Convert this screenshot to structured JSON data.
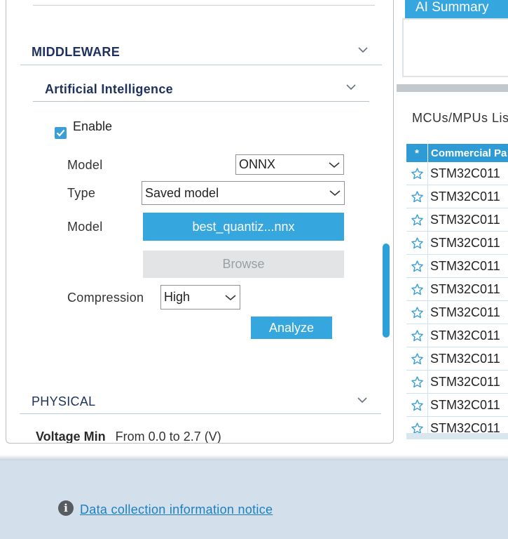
{
  "left_panel": {
    "middleware": {
      "title": "MIDDLEWARE"
    },
    "ai": {
      "title": "Artificial Intelligence",
      "enable_label": "Enable",
      "enabled": true,
      "model_label": "Model",
      "model_value": "ONNX",
      "type_label": "Type",
      "type_value": "Saved model",
      "model_file_label": "Model",
      "model_file_button": "best_quantiz...nnx",
      "browse_label": "Browse",
      "compression_label": "Compression",
      "compression_value": "High",
      "analyze_label": "Analyze"
    },
    "physical": {
      "title": "PHYSICAL"
    },
    "voltage": {
      "label": "Voltage Min",
      "value": "From 0.0 to 2.7 (V)"
    }
  },
  "right_panel": {
    "ai_summary_tab": "AI Summary",
    "mcus_title": "MCUs/MPUs Lis",
    "table": {
      "star_header": "*",
      "name_header": "Commercial Pa",
      "rows": [
        "STM32C011",
        "STM32C011",
        "STM32C011",
        "STM32C011",
        "STM32C011",
        "STM32C011",
        "STM32C011",
        "STM32C011",
        "STM32C011",
        "STM32C011",
        "STM32C011",
        "STM32C011"
      ]
    }
  },
  "footer": {
    "notice_link": "Data collection information notice"
  },
  "colors": {
    "accent": "#35a6de",
    "header_text": "#1e3260",
    "link": "#1d7fbf",
    "footer_bg": "#d3e0eb"
  }
}
